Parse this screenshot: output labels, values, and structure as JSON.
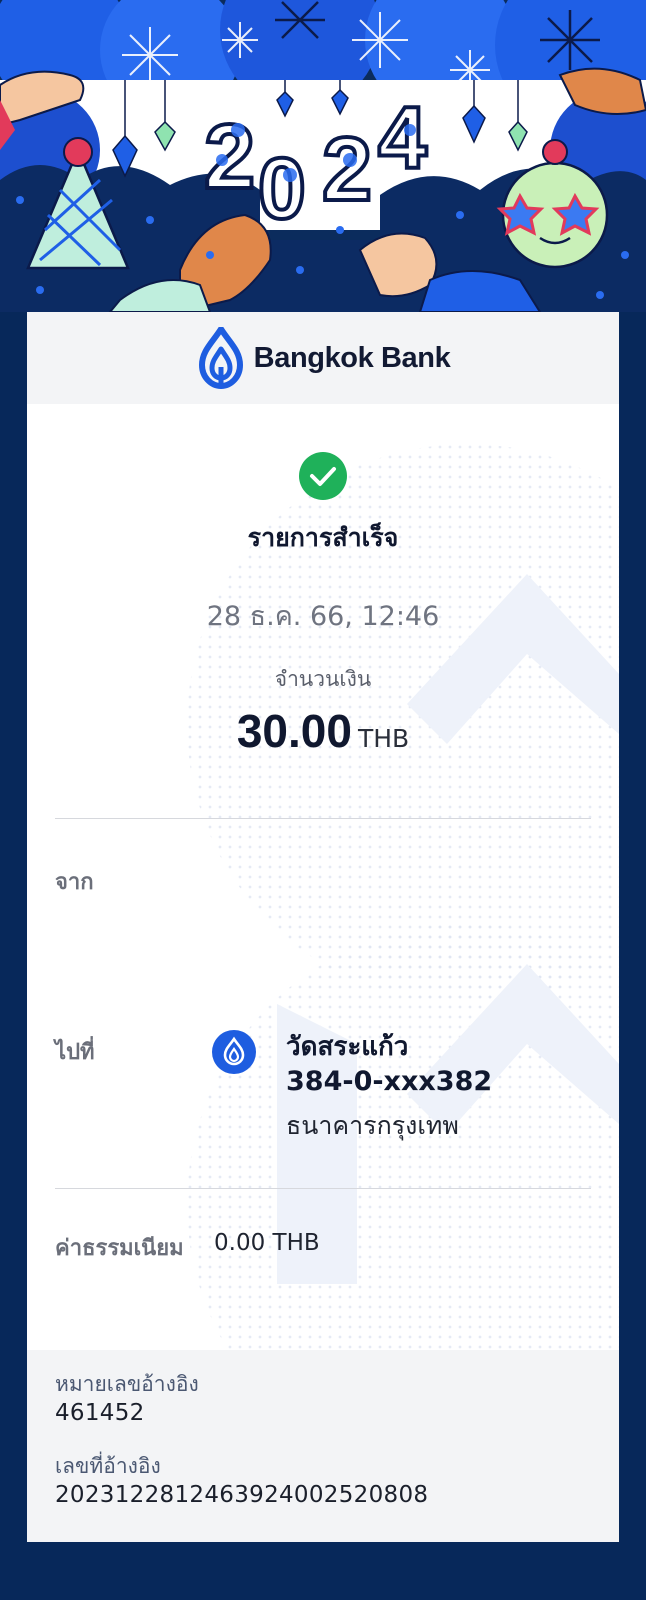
{
  "header": {
    "year_text": "2024"
  },
  "bank": {
    "name": "Bangkok Bank"
  },
  "status": {
    "title": "รายการสำเร็จ",
    "datetime": "28 ธ.ค. 66, 12:46",
    "amount_label": "จำนวนเงิน",
    "amount": "30.00",
    "currency": "THB"
  },
  "from": {
    "label": "จาก"
  },
  "to": {
    "label": "ไปที่",
    "name": "วัดสระแก้ว",
    "account": "384-0-xxx382",
    "bank": "ธนาคารกรุงเทพ"
  },
  "fee": {
    "label": "ค่าธรรมเนียม",
    "value": "0.00 THB"
  },
  "reference": {
    "ref_label": "หมายเลขอ้างอิง",
    "ref_value": "461452",
    "ref2_label": "เลขที่อ้างอิง",
    "ref2_value": "2023122812463924002520808"
  },
  "colors": {
    "background": "#07285a",
    "brand_blue": "#1e5de0",
    "success_green": "#1fb15a",
    "card": "#ffffff"
  },
  "icons": [
    "check-circle-icon",
    "bangkok-bank-logo-icon"
  ]
}
